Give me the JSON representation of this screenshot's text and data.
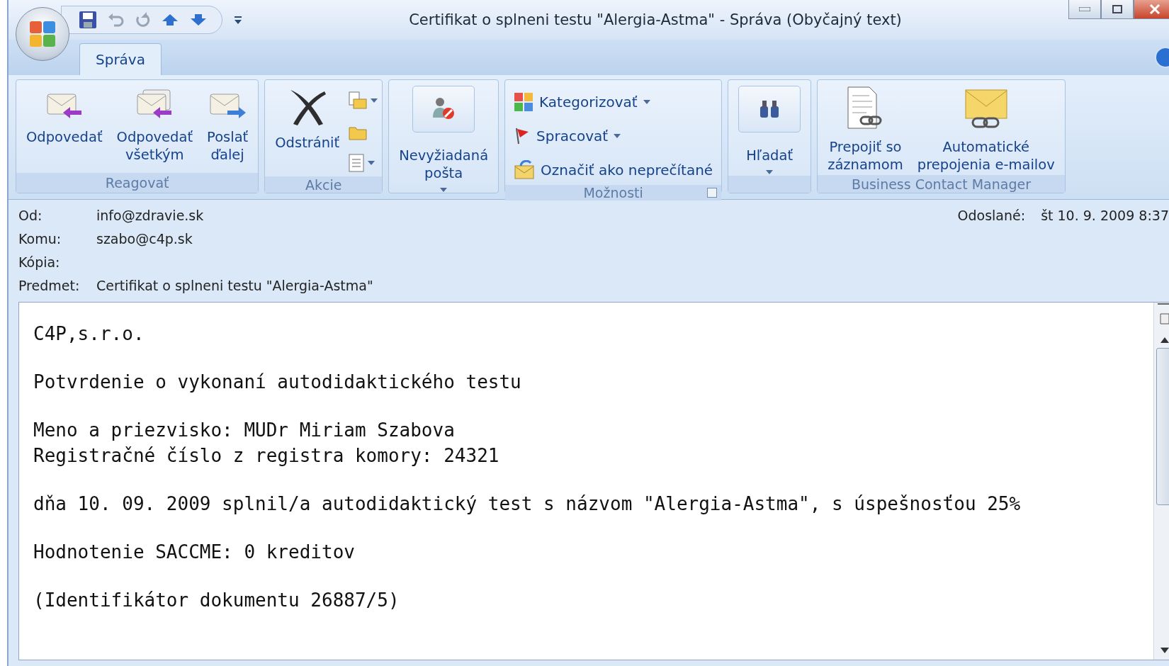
{
  "window": {
    "title": "Certifikat o splneni testu \"Alergia-Astma\" - Správa (Obyčajný text)"
  },
  "tabs": [
    {
      "label": "Správa",
      "selected": true
    }
  ],
  "ribbon": [
    {
      "label": "Reagovať",
      "items": [
        {
          "kind": "large",
          "lines": [
            "Odpovedať"
          ]
        },
        {
          "kind": "large",
          "lines": [
            "Odpovedať",
            "všetkým"
          ]
        },
        {
          "kind": "large",
          "lines": [
            "Poslať",
            "ďalej"
          ]
        }
      ]
    },
    {
      "label": "Akcie",
      "items": [
        {
          "kind": "large",
          "lines": [
            "Odstrániť"
          ]
        },
        {
          "kind": "small",
          "dropdown": true
        },
        {
          "kind": "small"
        },
        {
          "kind": "small",
          "dropdown": true
        }
      ]
    },
    {
      "items": [
        {
          "kind": "framed",
          "lines": [
            "Nevyžiadaná",
            "pošta"
          ],
          "dropdown": true
        }
      ]
    },
    {
      "label": "Možnosti",
      "launcher": true,
      "items": [
        {
          "kind": "row",
          "lines": [
            "Kategorizovať"
          ],
          "dropdown": true
        },
        {
          "kind": "row",
          "lines": [
            "Spracovať"
          ],
          "dropdown": true
        },
        {
          "kind": "row",
          "lines": [
            "Označiť ako neprečítané"
          ]
        }
      ]
    },
    {
      "items": [
        {
          "kind": "framed",
          "lines": [
            "Hľadať"
          ],
          "dropdown": true
        }
      ]
    },
    {
      "label": "Business Contact Manager",
      "items": [
        {
          "kind": "large",
          "lines": [
            "Prepojiť so",
            "záznamom"
          ]
        },
        {
          "kind": "large",
          "lines": [
            "Automatické",
            "prepojenia e-mailov"
          ]
        }
      ]
    }
  ],
  "header": {
    "fields": [
      {
        "label": "Od:",
        "value": "info@zdravie.sk"
      },
      {
        "label": "Komu:",
        "value": "szabo@c4p.sk"
      },
      {
        "label": "Kópia:"
      },
      {
        "label": "Predmet:",
        "value": "Certifikat o splneni testu \"Alergia-Astma\""
      }
    ],
    "sent": {
      "label": "Odoslané:",
      "value": "št 10. 9. 2009 8:37"
    }
  },
  "body": [
    [
      "C4P,s.r.o."
    ],
    [
      "Potvrdenie o vykonaní autodidaktického testu"
    ],
    [
      "Meno a priezvisko: MUDr Miriam Szabova",
      "Registračné číslo z registra komory: 24321"
    ],
    [
      "dňa 10. 09. 2009 splnil/a autodidaktický test s názvom \"Alergia-Astma\", s úspešnosťou 25%"
    ],
    [
      "Hodnotenie SACCME: 0 kreditov"
    ],
    [
      "(Identifikátor dokumentu 26887/5)"
    ]
  ]
}
